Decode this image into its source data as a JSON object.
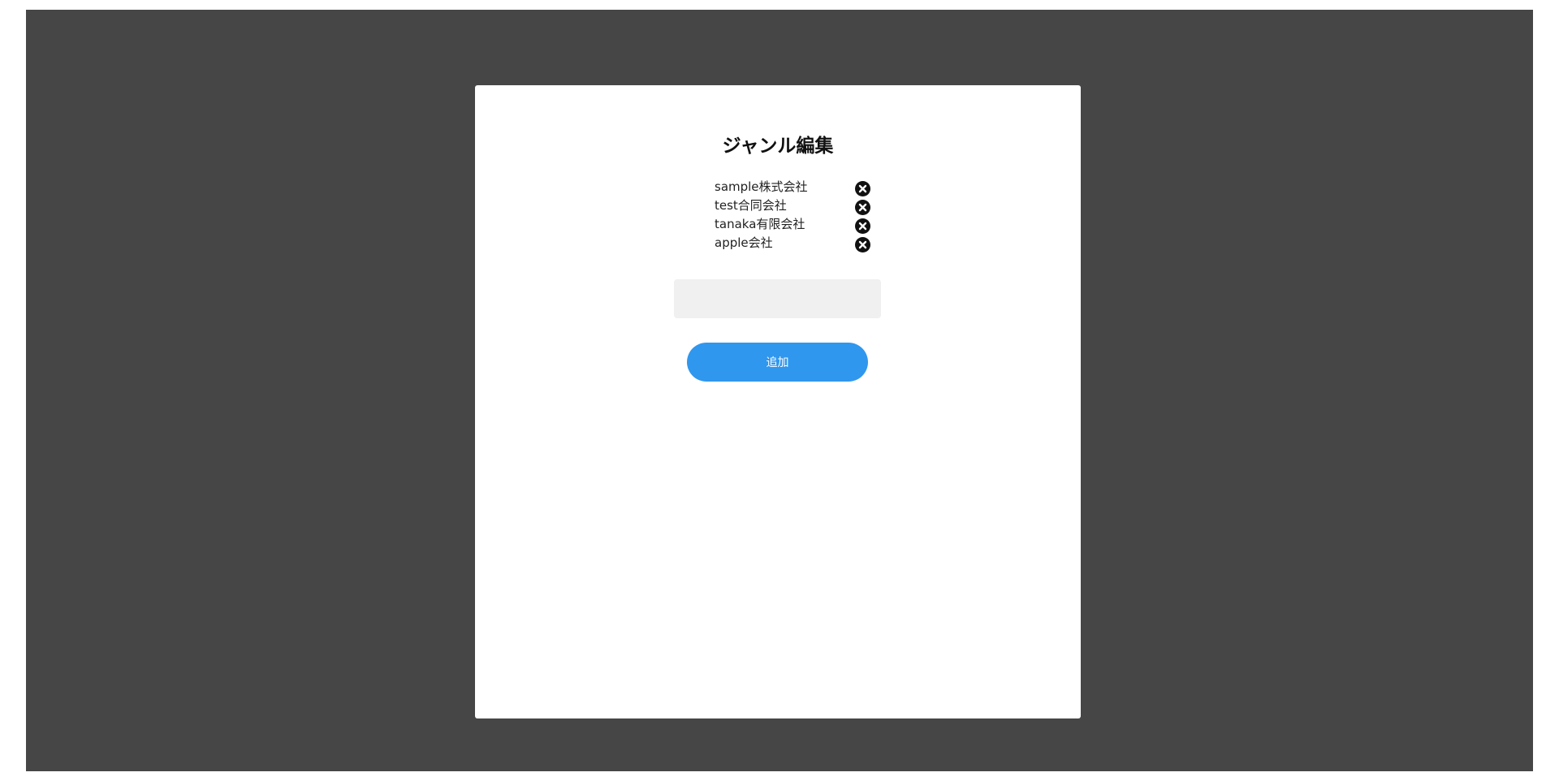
{
  "modal": {
    "title": "ジャンル編集",
    "genres": [
      {
        "label": "sample株式会社",
        "delete_icon": "close-circle-icon"
      },
      {
        "label": "test合同会社",
        "delete_icon": "close-circle-icon"
      },
      {
        "label": "tanaka有限会社",
        "delete_icon": "close-circle-icon"
      },
      {
        "label": "apple会社",
        "delete_icon": "close-circle-icon"
      }
    ],
    "input": {
      "value": "",
      "placeholder": ""
    },
    "add_button_label": "追加"
  },
  "colors": {
    "overlay": "#464646",
    "modal_background": "#ffffff",
    "input_background": "#f0f0f0",
    "accent": "#3097ee",
    "delete_icon": "#111111"
  }
}
